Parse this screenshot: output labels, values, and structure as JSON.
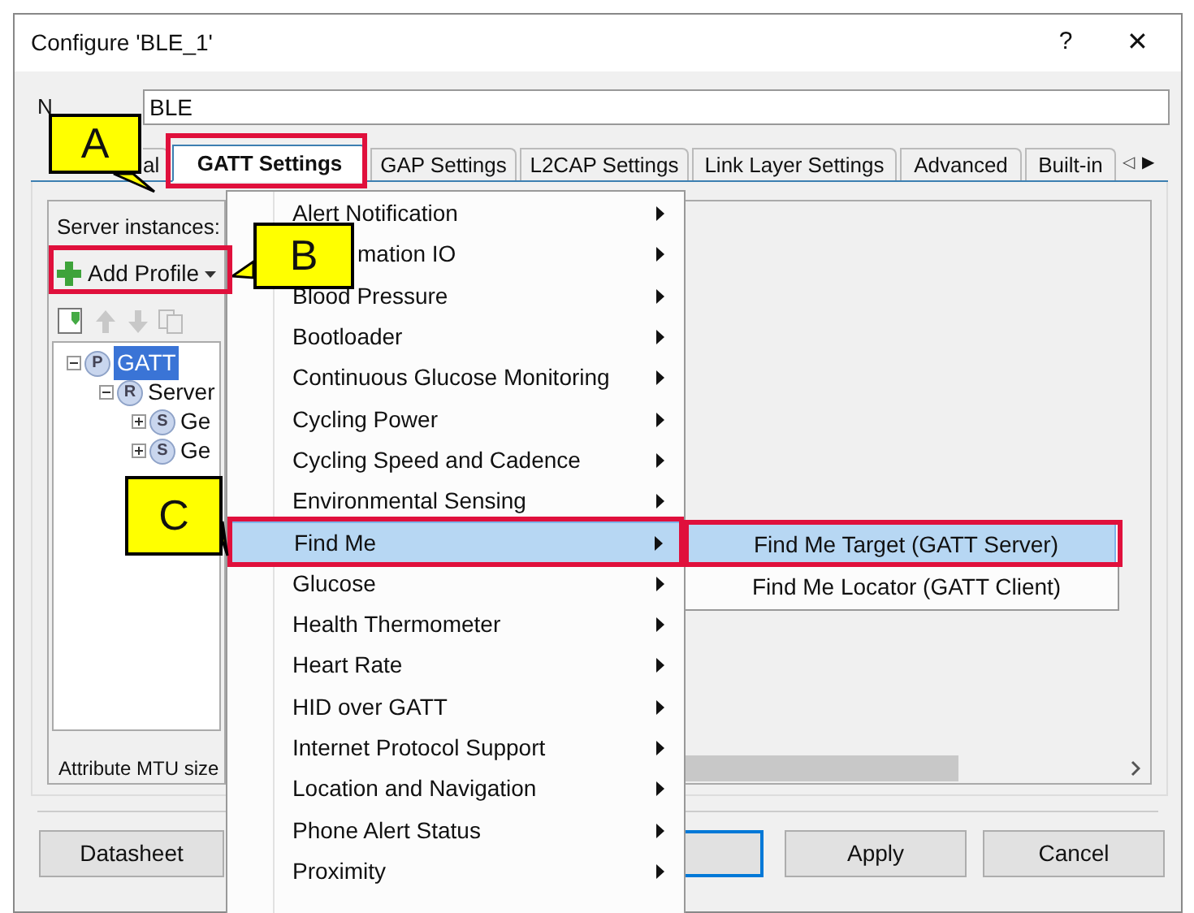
{
  "window": {
    "title": "Configure 'BLE_1'",
    "help": "?",
    "close": "✕"
  },
  "name_field": {
    "label": "N",
    "value": "BLE"
  },
  "tabs": [
    {
      "label": "al",
      "selected": false
    },
    {
      "label": "GATT Settings",
      "selected": true
    },
    {
      "label": "GAP Settings",
      "selected": false
    },
    {
      "label": "L2CAP Settings",
      "selected": false
    },
    {
      "label": "Link Layer Settings",
      "selected": false
    },
    {
      "label": "Advanced",
      "selected": false
    },
    {
      "label": "Built-in",
      "selected": false
    }
  ],
  "tab_scroll": {
    "left": "◁",
    "right": "▶"
  },
  "server_panel": {
    "label": "Server instances:",
    "add_button": "Add Profile",
    "tree": [
      {
        "icon_letter": "P",
        "label": "GATT",
        "selected": true,
        "expanded": true,
        "children": [
          {
            "icon_letter": "R",
            "label": "Server",
            "selected": false,
            "expanded": true,
            "children": [
              {
                "icon_letter": "S",
                "label": "Ge",
                "selected": false,
                "expanded": false
              },
              {
                "icon_letter": "S",
                "label": "Ge",
                "selected": false,
                "expanded": false
              }
            ]
          }
        ]
      }
    ],
    "mtu_label": "Attribute MTU size"
  },
  "buttons": [
    {
      "label": "Datasheet"
    },
    {
      "default": true
    },
    {
      "label": "Apply"
    },
    {
      "label": "Cancel"
    }
  ],
  "menu": [
    {
      "label": "Alert Notification",
      "selected": false
    },
    {
      "label": "mation IO",
      "selected": false
    },
    {
      "label": "Blood Pressure",
      "selected": false
    },
    {
      "label": "Bootloader",
      "selected": false
    },
    {
      "label": "Continuous Glucose Monitoring",
      "selected": false
    },
    {
      "label": "Cycling Power",
      "selected": false
    },
    {
      "label": "Cycling Speed and Cadence",
      "selected": false
    },
    {
      "label": "Environmental Sensing",
      "selected": false
    },
    {
      "label": "Find Me",
      "selected": true
    },
    {
      "label": "Glucose",
      "selected": false
    },
    {
      "label": "Health Thermometer",
      "selected": false
    },
    {
      "label": "Heart Rate",
      "selected": false
    },
    {
      "label": "HID over GATT",
      "selected": false
    },
    {
      "label": "Internet Protocol Support",
      "selected": false
    },
    {
      "label": "Location and Navigation",
      "selected": false
    },
    {
      "label": "Phone Alert Status",
      "selected": false
    },
    {
      "label": "Proximity",
      "selected": false
    }
  ],
  "submenu": [
    {
      "label": "Find Me Target (GATT Server)",
      "selected": true
    },
    {
      "label": "Find Me Locator (GATT Client)",
      "selected": false
    }
  ],
  "callouts": [
    {
      "label": "A"
    },
    {
      "label": "B"
    },
    {
      "label": "C"
    }
  ]
}
